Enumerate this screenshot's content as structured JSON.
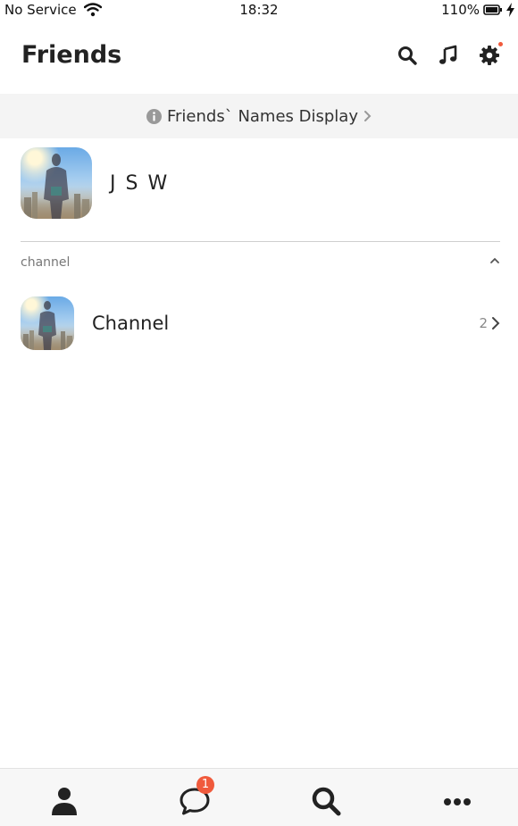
{
  "status_bar": {
    "carrier": "No Service",
    "time": "18:32",
    "battery": "110%"
  },
  "header": {
    "title": "Friends",
    "icons": [
      "search-icon",
      "music-icon",
      "settings-icon"
    ]
  },
  "names_display": {
    "label": "Friends` Names Display"
  },
  "profile": {
    "name": "J S W"
  },
  "section": {
    "label": "channel"
  },
  "channel": {
    "name": "Channel",
    "count": "2"
  },
  "bottom_nav": {
    "chat_badge": "1",
    "tabs": [
      "contacts-icon",
      "chat-icon",
      "search-icon",
      "more-icon"
    ]
  },
  "colors": {
    "badge": "#f05a3c",
    "icon": "#222222",
    "bar_bg": "#f4f4f4"
  }
}
